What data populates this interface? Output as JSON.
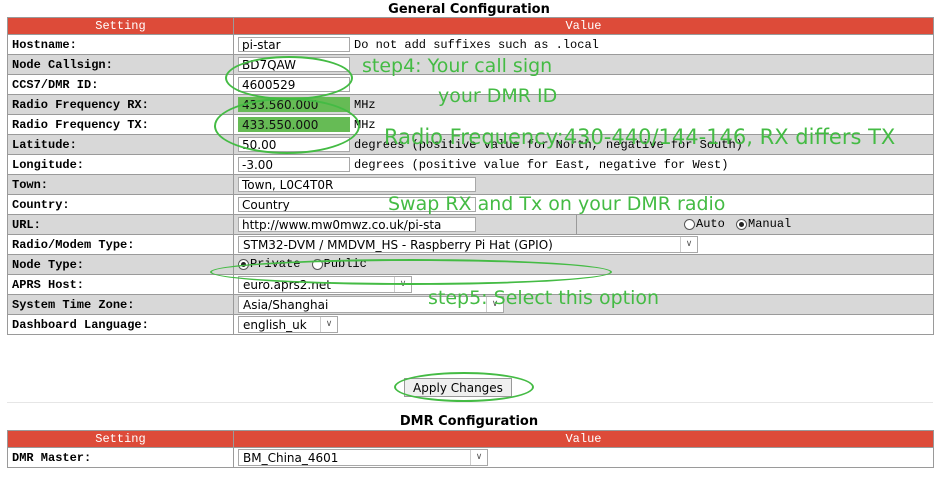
{
  "general": {
    "title": "General Configuration",
    "header_setting": "Setting",
    "header_value": "Value",
    "hostname": {
      "label": "Hostname:",
      "value": "pi-star",
      "note": "Do not add suffixes such as .local"
    },
    "callsign": {
      "label": "Node Callsign:",
      "value": "BD7QAW"
    },
    "dmr_id": {
      "label": "CCS7/DMR ID:",
      "value": "4600529"
    },
    "rx": {
      "label": "Radio Frequency RX:",
      "value": "433.560.000",
      "unit": "MHz"
    },
    "tx": {
      "label": "Radio Frequency TX:",
      "value": "433.550.000",
      "unit": "MHz"
    },
    "latitude": {
      "label": "Latitude:",
      "value": "50.00",
      "note": "degrees (positive value for North, negative for South)"
    },
    "longitude": {
      "label": "Longitude:",
      "value": "-3.00",
      "note": "degrees (positive value for East, negative for West)"
    },
    "town": {
      "label": "Town:",
      "value": "Town, L0C4T0R"
    },
    "country": {
      "label": "Country:",
      "value": "Country"
    },
    "url": {
      "label": "URL:",
      "value": "http://www.mw0mwz.co.uk/pi-sta",
      "auto_label": "Auto",
      "manual_label": "Manual",
      "selected": "Manual"
    },
    "modem": {
      "label": "Radio/Modem Type:",
      "value": "STM32-DVM / MMDVM_HS - Raspberry Pi Hat (GPIO)"
    },
    "node_type": {
      "label": "Node Type:",
      "private_label": "Private",
      "public_label": "Public",
      "selected": "Private"
    },
    "aprs": {
      "label": "APRS Host:",
      "value": "euro.aprs2.net"
    },
    "timezone": {
      "label": "System Time Zone:",
      "value": "Asia/Shanghai"
    },
    "language": {
      "label": "Dashboard Language:",
      "value": "english_uk"
    },
    "apply_label": "Apply Changes"
  },
  "dmr": {
    "title": "DMR Configuration",
    "header_setting": "Setting",
    "header_value": "Value",
    "master": {
      "label": "DMR Master:",
      "value": "BM_China_4601"
    }
  },
  "annotations": {
    "step4": "step4: Your call sign",
    "dmr_id": "your DMR ID",
    "freq": "Radio Frequency:430-440/144-146, RX differs TX",
    "swap": "Swap RX and Tx on your DMR radio",
    "step5": "step5: Select this option"
  },
  "colors": {
    "header_bg": "#dd4b39",
    "annotation": "#44bb44",
    "freq_highlight": "#66bb55"
  }
}
